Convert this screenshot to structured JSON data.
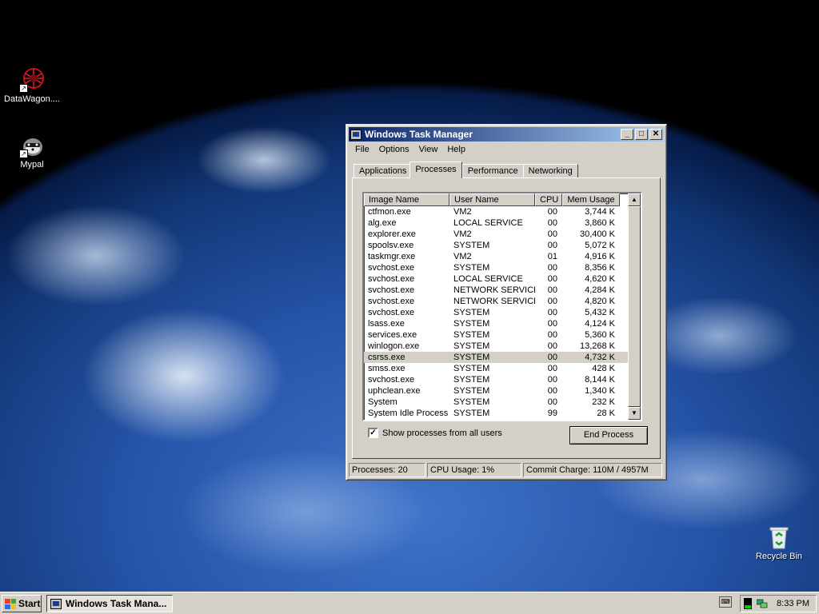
{
  "desktop": {
    "icons": [
      {
        "label": "DataWagon....",
        "icon": "datawagon-icon"
      },
      {
        "label": "Mypal",
        "icon": "mypal-icon"
      },
      {
        "label": "Recycle Bin",
        "icon": "recycle-bin-icon"
      }
    ]
  },
  "window": {
    "title": "Windows Task Manager",
    "controls": {
      "minimize": "_",
      "maximize": "□",
      "close": "✕"
    },
    "menu": [
      "File",
      "Options",
      "View",
      "Help"
    ],
    "tabs": [
      "Applications",
      "Processes",
      "Performance",
      "Networking"
    ],
    "active_tab": "Processes",
    "columns": [
      "Image Name",
      "User Name",
      "CPU",
      "Mem Usage"
    ],
    "processes": [
      {
        "name": "ctfmon.exe",
        "user": "VM2",
        "cpu": "00",
        "mem": "3,744 K"
      },
      {
        "name": "alg.exe",
        "user": "LOCAL SERVICE",
        "cpu": "00",
        "mem": "3,860 K"
      },
      {
        "name": "explorer.exe",
        "user": "VM2",
        "cpu": "00",
        "mem": "30,400 K"
      },
      {
        "name": "spoolsv.exe",
        "user": "SYSTEM",
        "cpu": "00",
        "mem": "5,072 K"
      },
      {
        "name": "taskmgr.exe",
        "user": "VM2",
        "cpu": "01",
        "mem": "4,916 K"
      },
      {
        "name": "svchost.exe",
        "user": "SYSTEM",
        "cpu": "00",
        "mem": "8,356 K"
      },
      {
        "name": "svchost.exe",
        "user": "LOCAL SERVICE",
        "cpu": "00",
        "mem": "4,620 K"
      },
      {
        "name": "svchost.exe",
        "user": "NETWORK SERVICE",
        "cpu": "00",
        "mem": "4,284 K"
      },
      {
        "name": "svchost.exe",
        "user": "NETWORK SERVICE",
        "cpu": "00",
        "mem": "4,820 K"
      },
      {
        "name": "svchost.exe",
        "user": "SYSTEM",
        "cpu": "00",
        "mem": "5,432 K"
      },
      {
        "name": "lsass.exe",
        "user": "SYSTEM",
        "cpu": "00",
        "mem": "4,124 K"
      },
      {
        "name": "services.exe",
        "user": "SYSTEM",
        "cpu": "00",
        "mem": "5,360 K"
      },
      {
        "name": "winlogon.exe",
        "user": "SYSTEM",
        "cpu": "00",
        "mem": "13,268 K"
      },
      {
        "name": "csrss.exe",
        "user": "SYSTEM",
        "cpu": "00",
        "mem": "4,732 K",
        "selected": true
      },
      {
        "name": "smss.exe",
        "user": "SYSTEM",
        "cpu": "00",
        "mem": "428 K"
      },
      {
        "name": "svchost.exe",
        "user": "SYSTEM",
        "cpu": "00",
        "mem": "8,144 K"
      },
      {
        "name": "uphclean.exe",
        "user": "SYSTEM",
        "cpu": "00",
        "mem": "1,340 K"
      },
      {
        "name": "System",
        "user": "SYSTEM",
        "cpu": "00",
        "mem": "232 K"
      },
      {
        "name": "System Idle Process",
        "user": "SYSTEM",
        "cpu": "99",
        "mem": "28 K"
      }
    ],
    "show_all_users": {
      "label": "Show processes from all users",
      "checked": true
    },
    "end_process_label": "End Process",
    "status": {
      "processes": "Processes: 20",
      "cpu_usage": "CPU Usage: 1%",
      "commit_charge": "Commit Charge: 110M / 4957M"
    }
  },
  "taskbar": {
    "start_label": "Start",
    "task_button_label": "Windows Task Mana...",
    "clock": "8:33 PM"
  },
  "colors": {
    "titlebar_start": "#0a246a",
    "titlebar_end": "#a6caf0",
    "face": "#d4d0c8"
  }
}
